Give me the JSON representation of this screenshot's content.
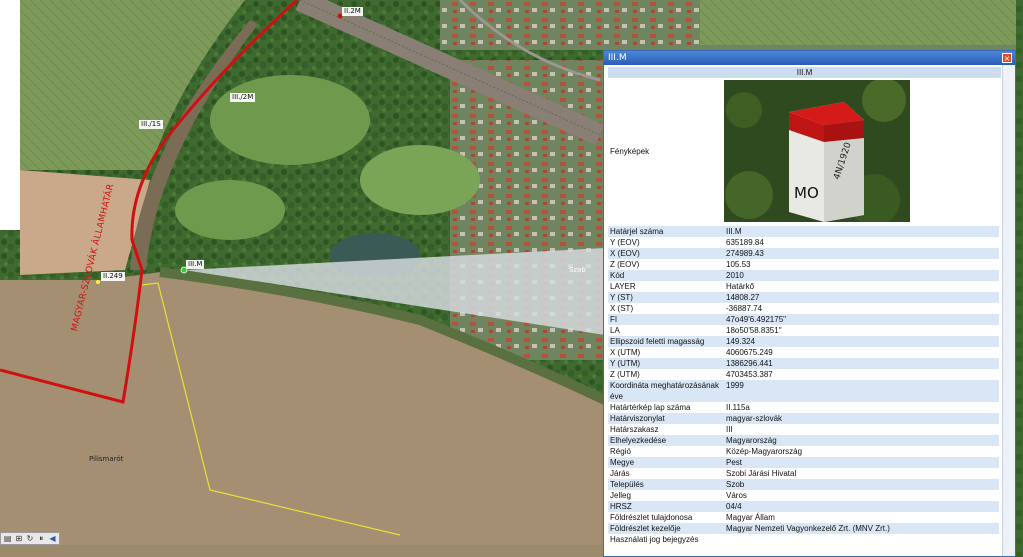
{
  "map": {
    "labels": {
      "m1": "II.2M",
      "m2": "III./2M",
      "m3": "III./1S",
      "m4": "II.249",
      "m5": "III.M",
      "town_szob": "Szob",
      "town_pilismarot": "Pilismarót"
    },
    "border_text": "MAGYAR-SZLOVÁK ÁLLAMHATÁR",
    "colors": {
      "border": "#d01010",
      "yellow_line": "#e8e03a",
      "river": "#a58f72"
    }
  },
  "toolbar": {
    "icons": [
      "layers-icon",
      "grid-icon",
      "refresh-icon",
      "pause-icon",
      "collapse-icon"
    ]
  },
  "panel": {
    "title": "III.M",
    "photo_header": "III.M",
    "photo_label": "Fényképek",
    "photo_marker": {
      "line1": "4N/1920",
      "line2": "MO"
    },
    "rows": [
      {
        "key": "Határjel száma",
        "value": "III.M"
      },
      {
        "key": "Y (EOV)",
        "value": "635189.84"
      },
      {
        "key": "X (EOV)",
        "value": "274989.43"
      },
      {
        "key": "Z (EOV)",
        "value": "105.53"
      },
      {
        "key": "Kód",
        "value": "2010"
      },
      {
        "key": "LAYER",
        "value": "Határkő"
      },
      {
        "key": "Y (ST)",
        "value": "14808.27"
      },
      {
        "key": "X (ST)",
        "value": "-36887.74"
      },
      {
        "key": "FI",
        "value": "47o49'6.492175\""
      },
      {
        "key": "LA",
        "value": "18o50'58.8351\""
      },
      {
        "key": "Ellipszoid feletti magasság",
        "value": "149.324"
      },
      {
        "key": "X (UTM)",
        "value": "4060675.249"
      },
      {
        "key": "Y (UTM)",
        "value": "1386296.441"
      },
      {
        "key": "Z (UTM)",
        "value": "4703453.387"
      },
      {
        "key": "Koordináta meghatározásának éve",
        "value": "1999"
      },
      {
        "key": "Határtérkép lap száma",
        "value": "II.115a"
      },
      {
        "key": "Határviszonylat",
        "value": "magyar-szlovák"
      },
      {
        "key": "Határszakasz",
        "value": "III"
      },
      {
        "key": "Elhelyezkedése",
        "value": "Magyarország"
      },
      {
        "key": "Régió",
        "value": "Közép-Magyarország"
      },
      {
        "key": "Megye",
        "value": "Pest"
      },
      {
        "key": "Járás",
        "value": "Szobi Járási Hivatal"
      },
      {
        "key": "Település",
        "value": "Szob"
      },
      {
        "key": "Jelleg",
        "value": "Város"
      },
      {
        "key": "HRSZ",
        "value": "04/4"
      },
      {
        "key": "Földrészlet tulajdonosa",
        "value": "Magyar Állam"
      },
      {
        "key": "Földrészlet kezelője",
        "value": "Magyar Nemzeti Vagyonkezelő Zrt. (MNV Zrt.)"
      },
      {
        "key": "Használati jog bejegyzés",
        "value": ""
      }
    ]
  }
}
